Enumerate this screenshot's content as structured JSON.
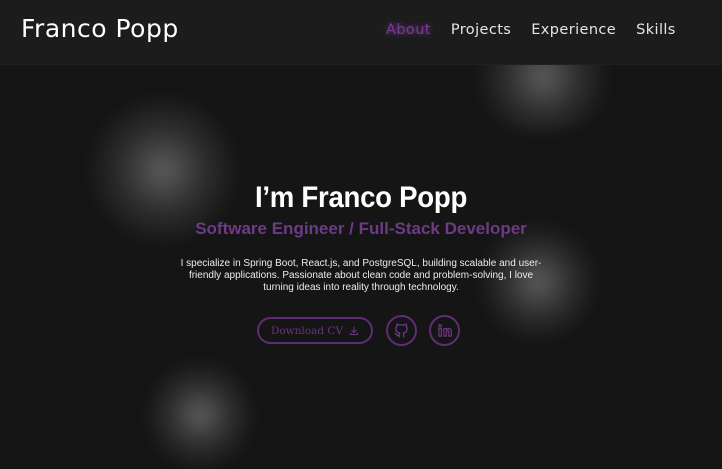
{
  "header": {
    "brand": "Franco Popp",
    "nav": [
      {
        "label": "About",
        "active": true
      },
      {
        "label": "Projects",
        "active": false
      },
      {
        "label": "Experience",
        "active": false
      },
      {
        "label": "Skills",
        "active": false
      }
    ]
  },
  "hero": {
    "title": "I’m Franco Popp",
    "subtitle": "Software Engineer / Full-Stack Developer",
    "description": "I specialize in Spring Boot, React.js, and PostgreSQL, building scalable and user-friendly applications. Passionate about clean code and problem-solving, I love turning ideas into reality through technology."
  },
  "actions": {
    "cv_label": "Download CV",
    "cv_icon": "download-icon",
    "social": [
      {
        "name": "github-icon"
      },
      {
        "name": "linkedin-icon"
      }
    ]
  },
  "colors": {
    "accent": "#6e3a86",
    "background": "#151515",
    "navbar": "#1c1c1c"
  }
}
